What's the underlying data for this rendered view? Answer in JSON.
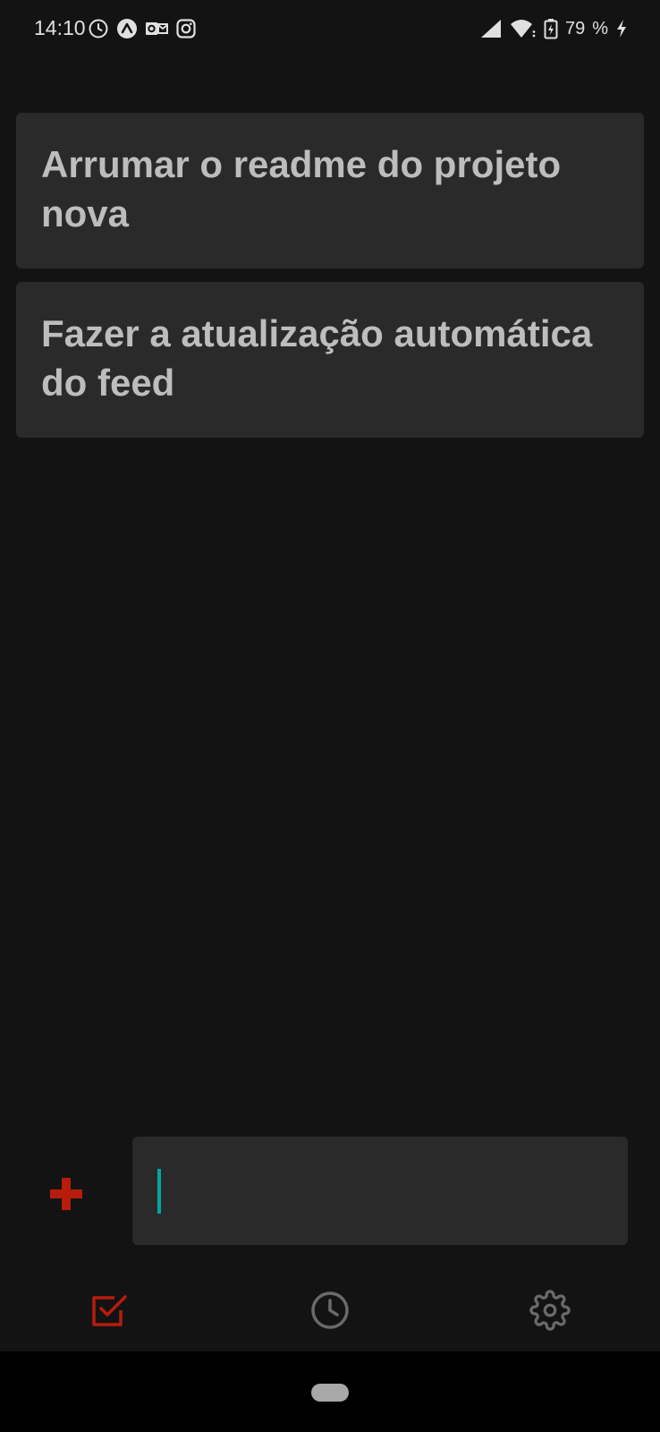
{
  "status_bar": {
    "time": "14:10",
    "battery_level": "79",
    "battery_suffix": "%",
    "icons_left": [
      "clock-icon",
      "expo-icon",
      "outlook-icon",
      "instagram-icon"
    ],
    "icons_right": [
      "signal-icon",
      "wifi-icon",
      "battery-charging-icon"
    ]
  },
  "tasks": [
    {
      "text": "Arrumar o readme do projeto nova"
    },
    {
      "text": "Fazer a atualização automática do feed"
    }
  ],
  "input": {
    "value": "",
    "placeholder": ""
  },
  "add_button": {
    "icon": "plus-icon",
    "color": "#b71c0c"
  },
  "bottom_nav": {
    "items": [
      {
        "icon": "checkbox-icon",
        "active": true
      },
      {
        "icon": "clock-icon",
        "active": false
      },
      {
        "icon": "gear-icon",
        "active": false
      }
    ]
  },
  "colors": {
    "background": "#131313",
    "card": "#2a2a2a",
    "text": "#bdbdbd",
    "accent": "#b71c0c",
    "caret": "#00a99d",
    "inactive_icon": "#6a6a6a"
  }
}
